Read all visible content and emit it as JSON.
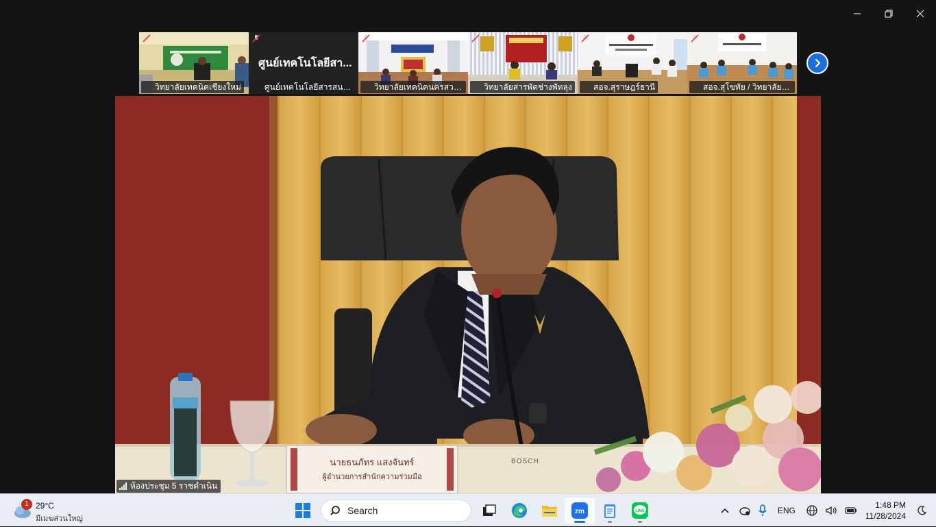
{
  "window": {
    "controls": [
      "minimize",
      "restore",
      "close"
    ]
  },
  "gallery": {
    "tiles": [
      {
        "name": "วิทยาลัยเทคนิคเชียงใหม่",
        "type": "video",
        "big_text": ""
      },
      {
        "name": "ศูนย์เทคโนโลยีสารสนเทศแ...",
        "type": "name-only",
        "big_text": "ศูนย์เทคโนโลยีสา..."
      },
      {
        "name": "วิทยาลัยเทคนิคนครสวรร...",
        "type": "video",
        "big_text": ""
      },
      {
        "name": "วิทยาลัยสารพัดช่างพัทลุง",
        "type": "video",
        "big_text": ""
      },
      {
        "name": "สอจ.สุราษฎร์ธานี",
        "type": "video",
        "big_text": ""
      },
      {
        "name": "สอจ.สุโขทัย / วิทยาลัยเท...",
        "type": "video",
        "big_text": ""
      }
    ],
    "next_icon": "chevron-right-icon"
  },
  "main_video": {
    "room_label": "ห้องประชุม 5 ราชดำเนิน",
    "nameplate_line1": "นายธนภัทร แสงจันทร์",
    "nameplate_line2": "ผู้อำนวยการสำนักความร่วมมือ",
    "mic_brand": "BOSCH"
  },
  "taskbar": {
    "weather": {
      "badge": "1",
      "temperature": "29°C",
      "description": "มีเมฆส่วนใหญ่"
    },
    "search_label": "Search",
    "apps": [
      "windows-start",
      "search",
      "task-view",
      "edge",
      "file-explorer",
      "zoom",
      "notepad",
      "line"
    ],
    "tray": {
      "language": "ENG",
      "time": "1:48 PM",
      "date": "11/28/2024"
    }
  },
  "colors": {
    "accent": "#1a6fe0",
    "taskbar_bg": "#e9eef5",
    "window_bg": "#141414"
  }
}
